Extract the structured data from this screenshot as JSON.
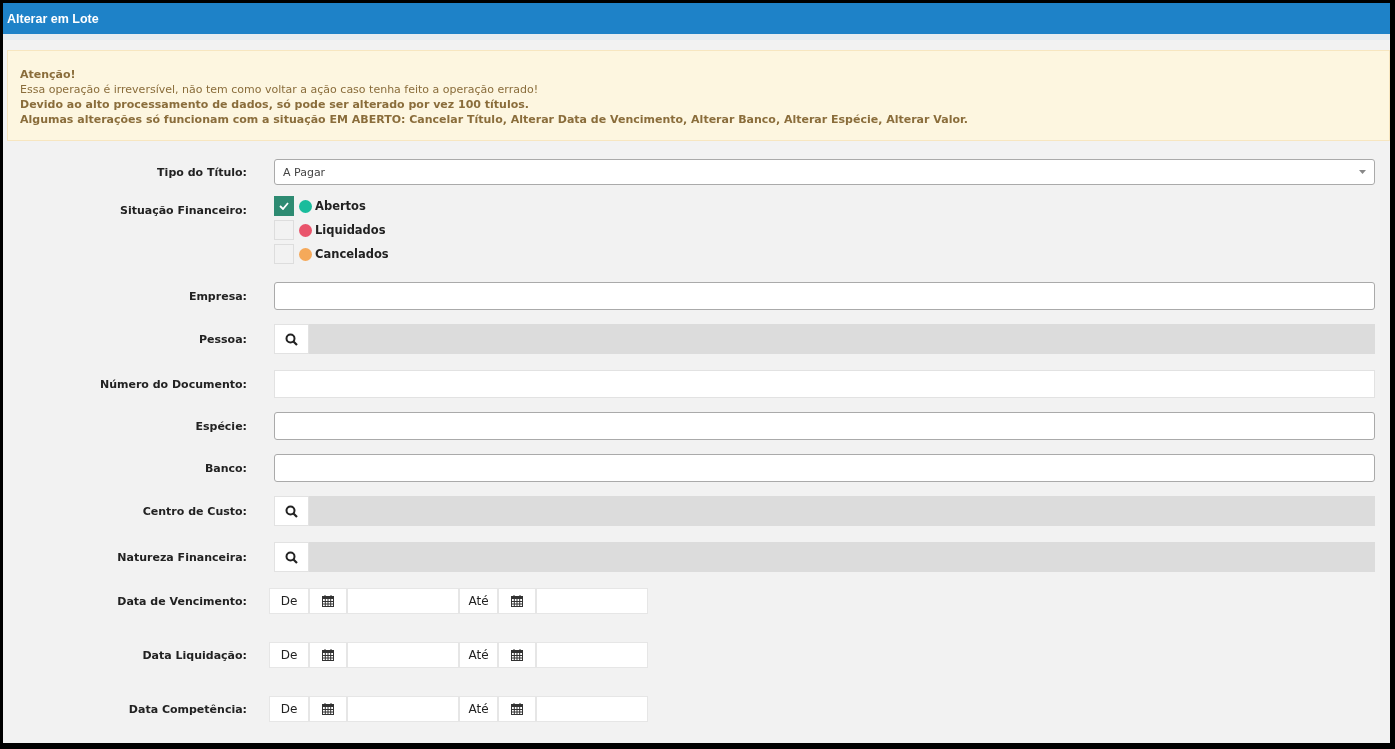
{
  "window": {
    "title": "Alterar em Lote"
  },
  "warning": {
    "title": "Atenção!",
    "lines": [
      {
        "text": "Essa operação é irreversível, não tem como voltar a ação caso tenha feito a operação errado!",
        "bold": false
      },
      {
        "text": "Devido ao alto processamento de dados, só pode ser alterado por vez 100 títulos.",
        "bold": true
      },
      {
        "text": "Algumas alterações só funcionam com a situação EM ABERTO: Cancelar Título, Alterar Data de Vencimento, Alterar Banco, Alterar Espécie, Alterar Valor.",
        "bold": true
      }
    ]
  },
  "form": [
    {
      "kind": "select",
      "label": "Tipo do Título:",
      "value": "A Pagar"
    },
    {
      "kind": "checks",
      "label": "Situação Financeiro:",
      "options": [
        {
          "label": "Abertos",
          "checked": true,
          "color": "#1abc9c"
        },
        {
          "label": "Liquidados",
          "checked": false,
          "color": "#e9546b"
        },
        {
          "label": "Cancelados",
          "checked": false,
          "color": "#f5a95a"
        }
      ]
    },
    {
      "kind": "text",
      "label": "Empresa:"
    },
    {
      "kind": "lookup",
      "label": "Pessoa:"
    },
    {
      "kind": "plain",
      "label": "Número do Documento:"
    },
    {
      "kind": "text",
      "label": "Espécie:"
    },
    {
      "kind": "text",
      "label": "Banco:"
    },
    {
      "kind": "lookup",
      "label": "Centro de Custo:"
    },
    {
      "kind": "lookup",
      "label": "Natureza Financeira:"
    },
    {
      "kind": "daterange",
      "label": "Data de Vencimento:",
      "from": "De",
      "to": "Até"
    },
    {
      "kind": "daterange",
      "label": "Data Liquidação:",
      "from": "De",
      "to": "Até"
    },
    {
      "kind": "daterange",
      "label": "Data Competência:",
      "from": "De",
      "to": "Até"
    }
  ]
}
